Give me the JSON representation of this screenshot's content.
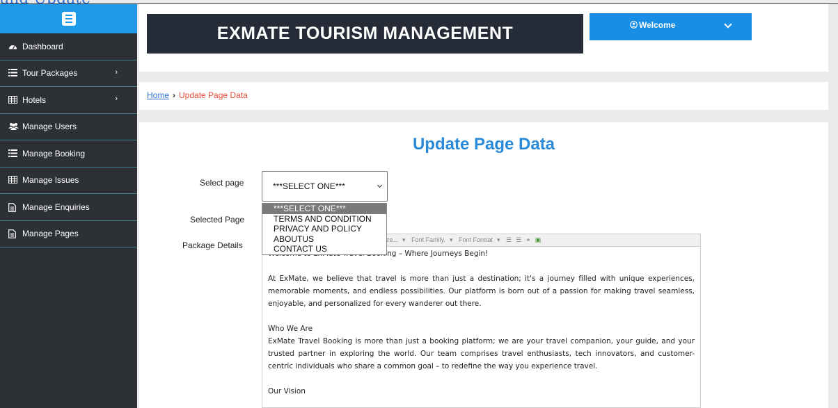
{
  "top_text": "and Update",
  "sidebar": {
    "items": [
      {
        "label": "Dashboard",
        "icon": "dashboard-icon",
        "has_chevron": false
      },
      {
        "label": "Tour Packages",
        "icon": "list-icon",
        "has_chevron": true
      },
      {
        "label": "Hotels",
        "icon": "table-icon",
        "has_chevron": true
      },
      {
        "label": "Manage Users",
        "icon": "users-icon",
        "has_chevron": false
      },
      {
        "label": "Manage Booking",
        "icon": "list-icon",
        "has_chevron": false
      },
      {
        "label": "Manage Issues",
        "icon": "table-icon",
        "has_chevron": false
      },
      {
        "label": "Manage Enquiries",
        "icon": "file-icon",
        "has_chevron": false
      },
      {
        "label": "Manage Pages",
        "icon": "file-icon",
        "has_chevron": false
      }
    ]
  },
  "header": {
    "brand": "EXMATE TOURISM MANAGEMENT",
    "welcome": "Welcome"
  },
  "breadcrumb": {
    "home": "Home",
    "current": "Update Page Data"
  },
  "main": {
    "title": "Update Page Data",
    "select_label": "Select page",
    "selected_page_label": "Selected Page",
    "package_details_label": "Package Details",
    "select_value": "***SELECT ONE***",
    "options": [
      "***SELECT ONE***",
      "TERMS AND CONDITION",
      "PRIVACY AND POLICY",
      "ABOUTUS",
      "CONTACT US"
    ],
    "toolbar": [
      "ze...",
      "Font Family.",
      "Font Format"
    ],
    "editor": {
      "intro": "Welcome to ExMate Travel Booking – Where Journeys Begin!",
      "p1": "At ExMate, we believe that travel is more than just a destination; it's a journey filled with unique experiences, memorable moments, and endless possibilities. Our platform is born out of a passion for making travel seamless, enjoyable, and personalized for every wanderer out there.",
      "h1": "Who We Are",
      "p2": "ExMate Travel Booking is more than just a booking platform; we are your travel companion, your guide, and your trusted partner in exploring the world. Our team comprises travel enthusiasts, tech innovators, and customer-centric individuals who share a common goal – to redefine the way you experience travel.",
      "h2": "Our Vision"
    }
  },
  "colors": {
    "sidebar_bg": "#2d3035",
    "accent_blue": "#1d9be8",
    "brand_bg": "#252b37",
    "title_blue": "#2a8ad8",
    "crumb_current": "#e64a3b"
  }
}
